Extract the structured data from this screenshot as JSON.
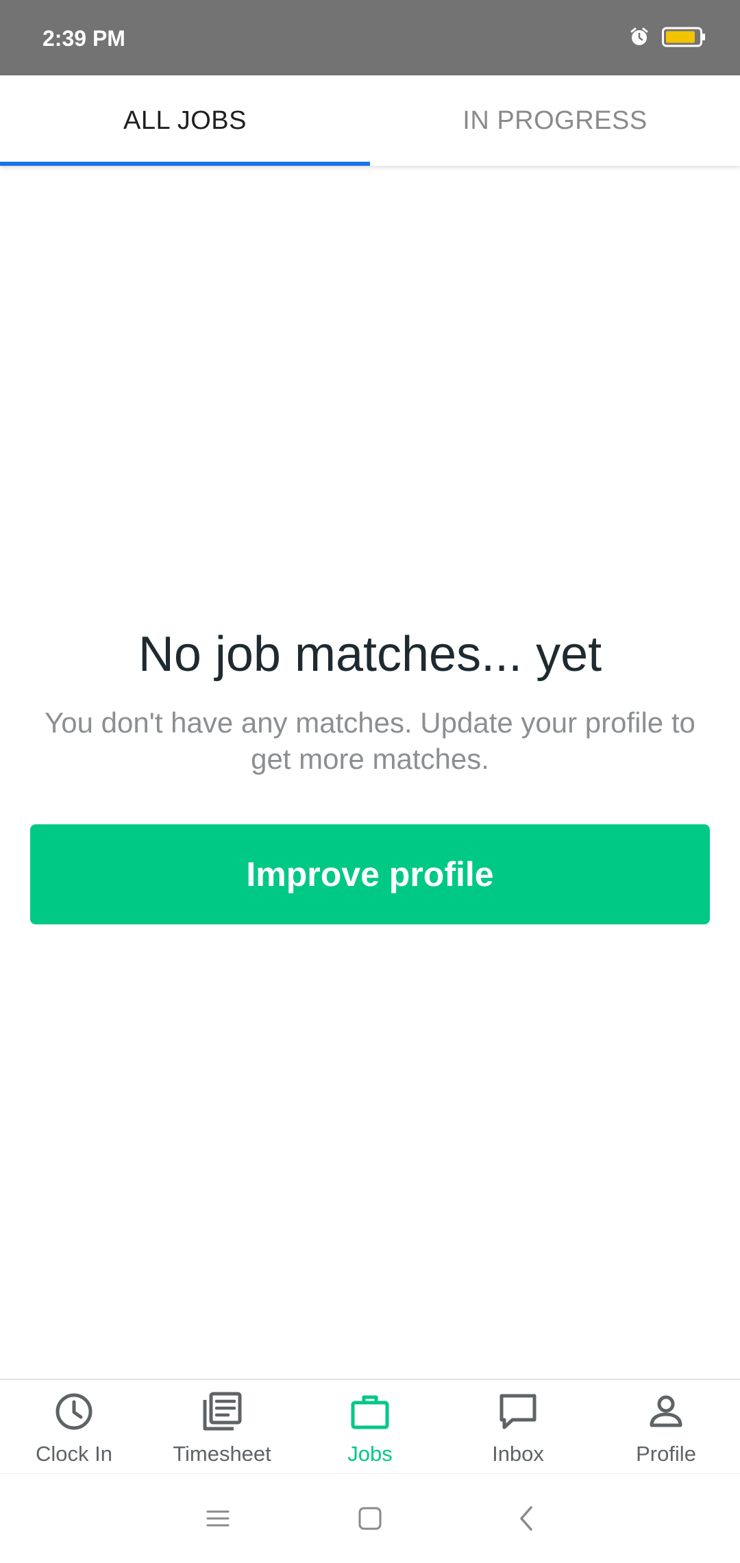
{
  "status_bar": {
    "time": "2:39 PM",
    "icons": [
      "alarm-icon",
      "battery-icon"
    ],
    "battery_color": "#f5c400"
  },
  "tabs": [
    {
      "label": "ALL JOBS",
      "active": true
    },
    {
      "label": "IN PROGRESS",
      "active": false
    }
  ],
  "empty_state": {
    "title": "No job matches... yet",
    "subtitle": "You don't have any matches. Update your profile to get more matches.",
    "button_label": "Improve profile"
  },
  "bottom_nav": {
    "items": [
      {
        "label": "Clock In",
        "icon": "clock-icon",
        "active": false
      },
      {
        "label": "Timesheet",
        "icon": "timesheet-icon",
        "active": false
      },
      {
        "label": "Jobs",
        "icon": "briefcase-icon",
        "active": true
      },
      {
        "label": "Inbox",
        "icon": "chat-icon",
        "active": false
      },
      {
        "label": "Profile",
        "icon": "person-icon",
        "active": false
      }
    ]
  },
  "system_nav": {
    "icons": [
      "menu-icon",
      "home-icon",
      "back-icon"
    ]
  },
  "colors": {
    "accent_green": "#00c885",
    "tab_indicator": "#1a73e8",
    "status_bar": "#737373"
  }
}
